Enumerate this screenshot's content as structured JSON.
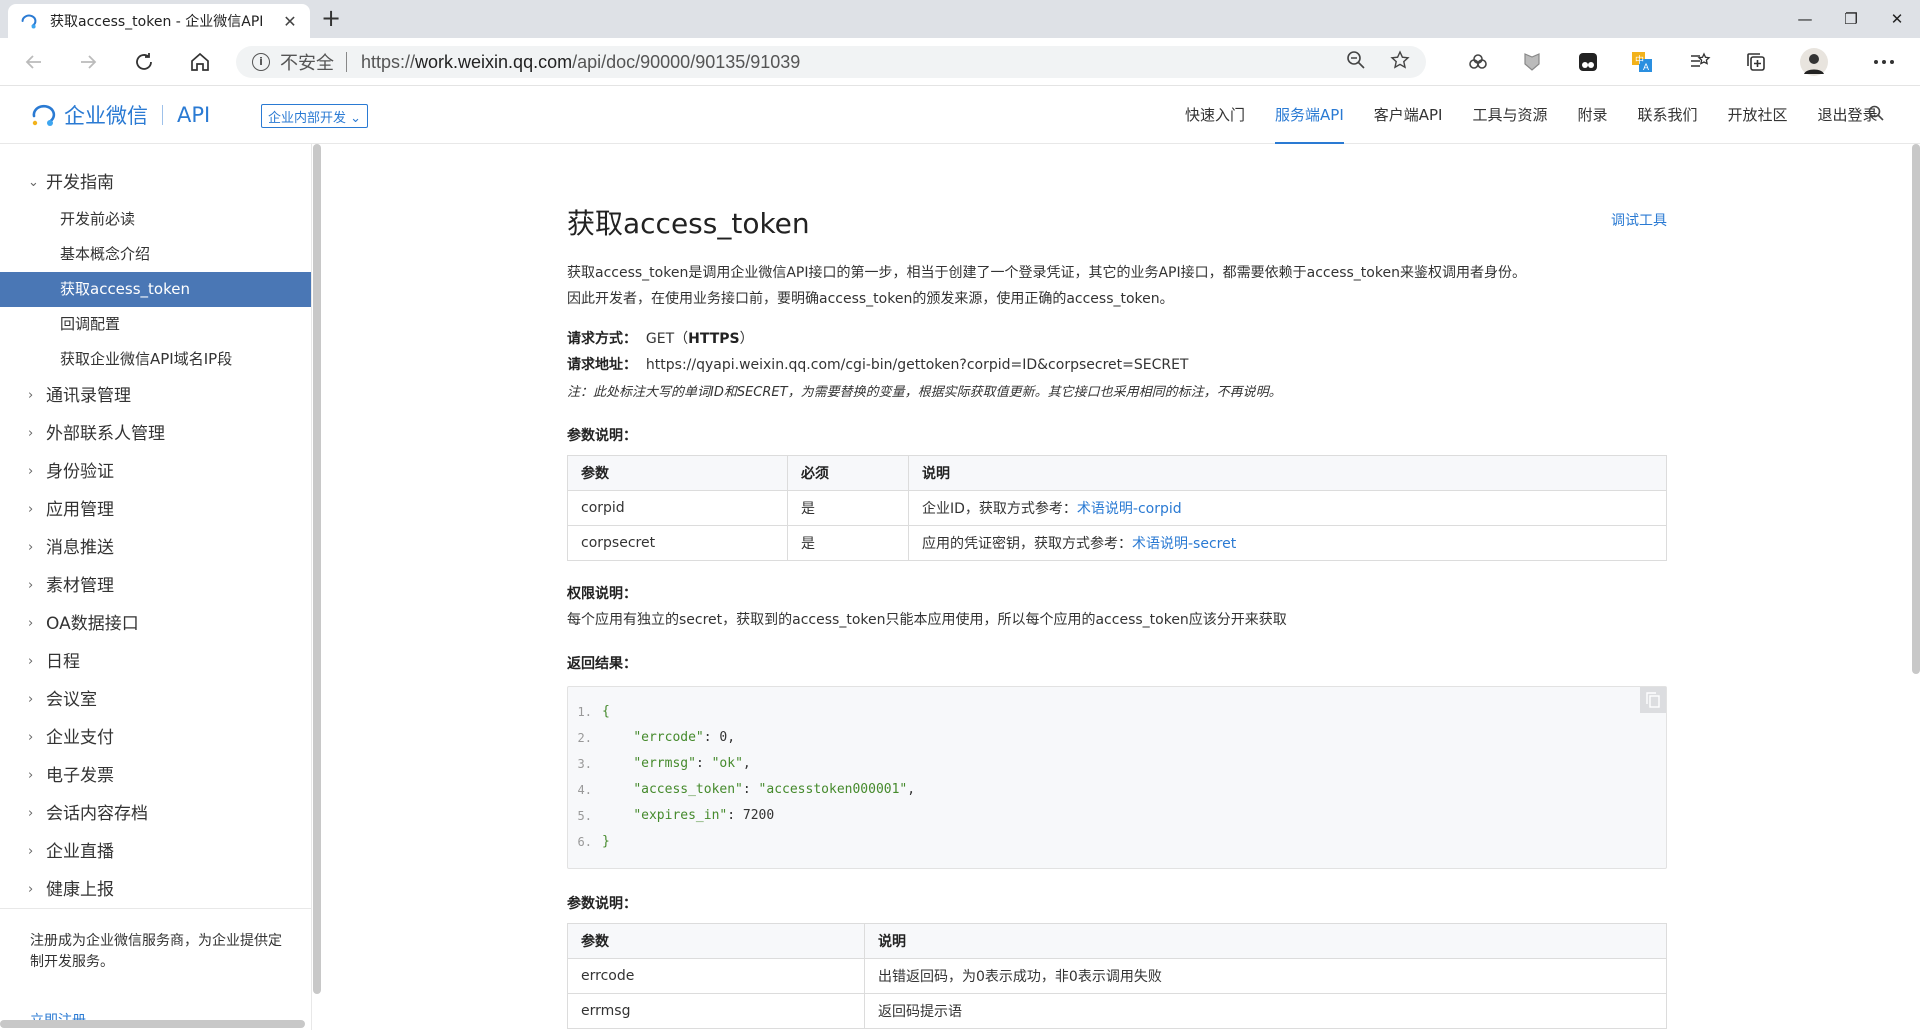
{
  "browser": {
    "tab_title": "获取access_token - 企业微信API",
    "tab_close": "✕",
    "new_tab": "+",
    "window_minimize": "—",
    "window_restore": "❐",
    "window_close": "✕",
    "insecure_label": "不安全",
    "url_prefix": "https://",
    "url_host": "work.weixin.qq.com",
    "url_path": "/api/doc/90000/90135/91039"
  },
  "header": {
    "logo_name": "企业微信",
    "logo_api": "API",
    "dev_select": "企业内部开发 ⌄",
    "nav": [
      {
        "label": "快速入门"
      },
      {
        "label": "服务端API"
      },
      {
        "label": "客户端API"
      },
      {
        "label": "工具与资源"
      },
      {
        "label": "附录"
      },
      {
        "label": "联系我们"
      },
      {
        "label": "开放社区"
      },
      {
        "label": "退出登录"
      }
    ],
    "active_nav": "服务端API"
  },
  "sidebar": {
    "open_group": "开发指南",
    "open_group_items": [
      {
        "label": "开发前必读"
      },
      {
        "label": "基本概念介绍"
      },
      {
        "label": "获取access_token"
      },
      {
        "label": "回调配置"
      },
      {
        "label": "获取企业微信API域名IP段"
      }
    ],
    "active_item": "获取access_token",
    "groups": [
      {
        "label": "通讯录管理"
      },
      {
        "label": "外部联系人管理"
      },
      {
        "label": "身份验证"
      },
      {
        "label": "应用管理"
      },
      {
        "label": "消息推送"
      },
      {
        "label": "素材管理"
      },
      {
        "label": "OA数据接口"
      },
      {
        "label": "日程"
      },
      {
        "label": "会议室"
      },
      {
        "label": "企业支付"
      },
      {
        "label": "电子发票"
      },
      {
        "label": "会话内容存档"
      },
      {
        "label": "企业直播"
      },
      {
        "label": "健康上报"
      }
    ],
    "footer_text": "注册成为企业微信服务商，为企业提供定制开发服务。",
    "footer_link": "立即注册"
  },
  "doc": {
    "title": "获取access_token",
    "debug_tool": "调试工具",
    "intro_1": "获取access_token是调用企业微信API接口的第一步，相当于创建了一个登录凭证，其它的业务API接口，都需要依赖于access_token来鉴权调用者身份。",
    "intro_2": "因此开发者，在使用业务接口前，要明确access_token的颁发来源，使用正确的access_token。",
    "method_label": "请求方式：",
    "method_value": "GET（",
    "method_proto": "HTTPS",
    "method_end": "）",
    "address_label": "请求地址：",
    "address_value": "https://qyapi.weixin.qq.com/cgi-bin/gettoken?corpid=ID&corpsecret=SECRET",
    "note": "注：此处标注大写的单词ID和SECRET，为需要替换的变量，根据实际获取值更新。其它接口也采用相同的标注，不再说明。",
    "params_heading": "参数说明：",
    "params_table": {
      "headers": [
        "参数",
        "必须",
        "说明"
      ],
      "rows": [
        {
          "param": "corpid",
          "required": "是",
          "desc": "企业ID，获取方式参考：",
          "link": "术语说明-corpid"
        },
        {
          "param": "corpsecret",
          "required": "是",
          "desc": "应用的凭证密钥，获取方式参考：",
          "link": "术语说明-secret"
        }
      ]
    },
    "perm_heading": "权限说明：",
    "perm_text": "每个应用有独立的secret，获取到的access_token只能本应用使用，所以每个应用的access_token应该分开来获取",
    "return_heading": "返回结果：",
    "code_lines": [
      {
        "n": "1.",
        "text": "{"
      },
      {
        "n": "2.",
        "key": "\"errcode\"",
        "val": "0",
        "comma": ","
      },
      {
        "n": "3.",
        "key": "\"errmsg\"",
        "strval": "\"ok\"",
        "comma": ","
      },
      {
        "n": "4.",
        "key": "\"access_token\"",
        "strval": "\"accesstoken000001\"",
        "comma": ","
      },
      {
        "n": "5.",
        "key": "\"expires_in\"",
        "val": "7200",
        "comma": ""
      },
      {
        "n": "6.",
        "text": "}"
      }
    ],
    "params2_heading": "参数说明：",
    "params2_table": {
      "headers": [
        "参数",
        "说明"
      ],
      "rows": [
        {
          "param": "errcode",
          "desc": "出错返回码，为0表示成功，非0表示调用失败"
        },
        {
          "param": "errmsg",
          "desc": "返回码提示语"
        }
      ]
    }
  },
  "colors": {
    "accent": "#2a7ad3",
    "sidebar_active": "#4a77b5"
  }
}
